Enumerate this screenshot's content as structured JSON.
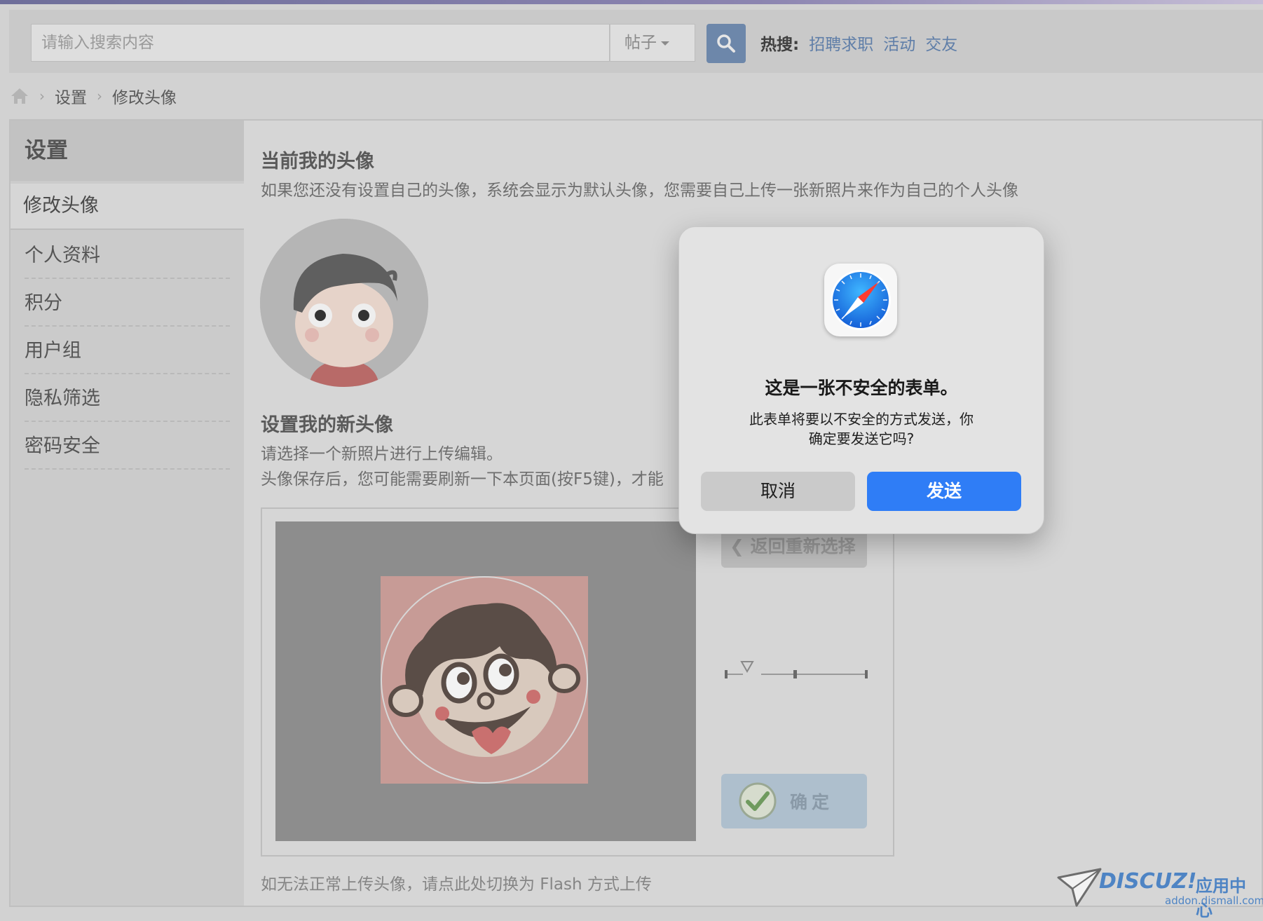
{
  "search": {
    "placeholder": "请输入搜索内容",
    "type_label": "帖子",
    "hot_label": "热搜:",
    "hot_links": [
      "招聘求职",
      "活动",
      "交友"
    ]
  },
  "breadcrumb": {
    "items": [
      "设置",
      "修改头像"
    ]
  },
  "sidebar": {
    "title": "设置",
    "active_item": "修改头像",
    "items": [
      "个人资料",
      "积分",
      "用户组",
      "隐私筛选",
      "密码安全"
    ]
  },
  "current_avatar": {
    "heading": "当前我的头像",
    "description": "如果您还没有设置自己的头像，系统会显示为默认头像，您需要自己上传一张新照片来作为自己的个人头像"
  },
  "new_avatar": {
    "heading": "设置我的新头像",
    "line1": "请选择一个新照片进行上传编辑。",
    "line2": "头像保存后，您可能需要刷新一下本页面(按F5键)，才能"
  },
  "editor": {
    "back_label": "返回重新选择",
    "confirm_label": "确定"
  },
  "footer_note": "如无法正常上传头像，请点此处切换为 Flash 方式上传",
  "watermark": {
    "brand": "DISCUZ!",
    "brand_cn": "应用中心",
    "url": "addon.dismall.com"
  },
  "dialog": {
    "title": "这是一张不安全的表单。",
    "message_line1": "此表单将要以不安全的方式发送，你",
    "message_line2": "确定要发送它吗?",
    "cancel_label": "取消",
    "send_label": "发送",
    "app_icon": "safari-compass-icon"
  },
  "colors": {
    "send_button": "#2f7df6",
    "link": "#5f7ea8",
    "search_button": "#6d87aa"
  }
}
